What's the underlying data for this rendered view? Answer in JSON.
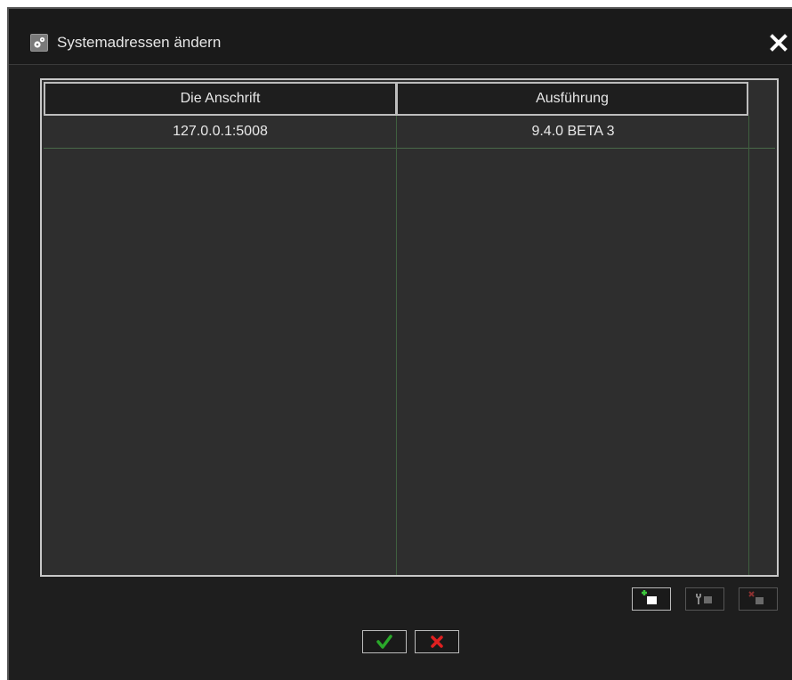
{
  "dialog": {
    "title": "Systemadressen ändern",
    "title_icon": "gears-icon",
    "close_icon": "close-icon"
  },
  "table": {
    "columns": [
      "Die Anschrift",
      "Ausführung"
    ],
    "rows": [
      [
        "127.0.0.1:5008",
        "9.4.0 BETA 3"
      ]
    ]
  },
  "toolbar": {
    "add_icon": "add-server-icon",
    "edit_icon": "edit-server-icon",
    "delete_icon": "delete-server-icon",
    "edit_enabled": false,
    "delete_enabled": false
  },
  "actions": {
    "ok_icon": "checkmark-icon",
    "cancel_icon": "cross-icon"
  },
  "colors": {
    "background": "#1e1e1e",
    "grid_background": "#2e2e2e",
    "grid_lines": "#3f5f3f",
    "ok_green": "#2aa82a",
    "cancel_red": "#e02020"
  }
}
